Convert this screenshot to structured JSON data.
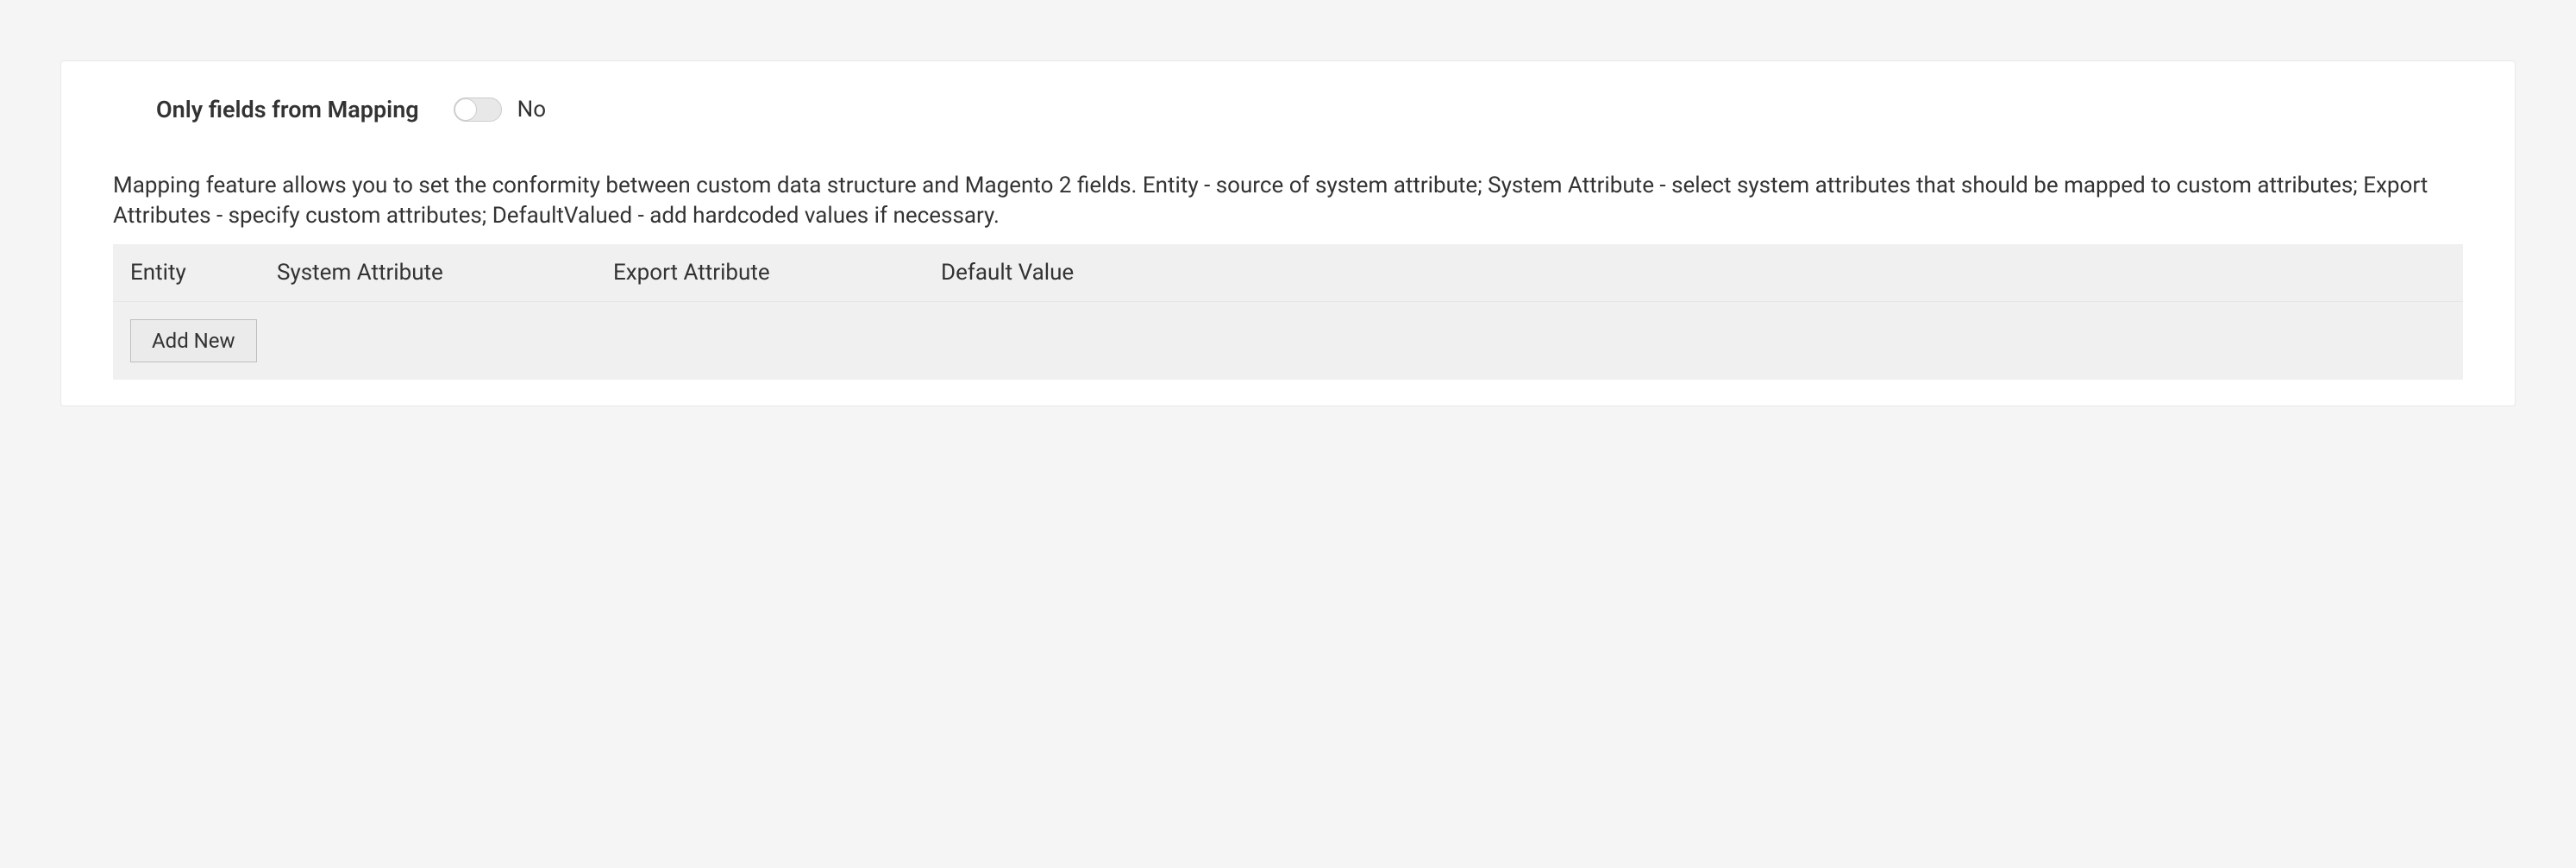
{
  "toggle": {
    "label": "Only fields from Mapping",
    "value": "No"
  },
  "description": "Mapping feature allows you to set the conformity between custom data structure and Magento 2 fields. Entity - source of system attribute; System Attribute - select system attributes that should be mapped to custom attributes; Export Attributes - specify custom attributes; DefaultValued - add hardcoded values if necessary.",
  "table": {
    "headers": {
      "entity": "Entity",
      "system_attribute": "System Attribute",
      "export_attribute": "Export Attribute",
      "default_value": "Default Value"
    }
  },
  "buttons": {
    "add_new": "Add New"
  }
}
